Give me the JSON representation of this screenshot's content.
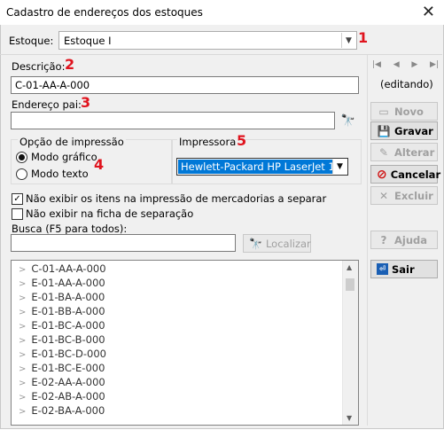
{
  "window": {
    "title": "Cadastro de endereços dos estoques",
    "close_glyph": "✕"
  },
  "stock": {
    "label": "Estoque:",
    "value": "Estoque I",
    "marker": "1"
  },
  "description": {
    "label": "Descrição:",
    "value": "C-01-AA-A-000",
    "marker": "2"
  },
  "parent_address": {
    "label": "Endereço pai:",
    "value": "",
    "marker": "3"
  },
  "print_option": {
    "label": "Opção de impressão",
    "options": [
      "Modo gráfico",
      "Modo texto"
    ],
    "selected": "Modo gráfico",
    "marker": "4"
  },
  "printer": {
    "label": "Impressora",
    "value": "Hewlett-Packard HP LaserJet 1",
    "marker": "5"
  },
  "checkboxes": [
    {
      "label": "Não exibir os itens na impressão de mercadorias a separar",
      "checked": true
    },
    {
      "label": "Não exibir na ficha de separação",
      "checked": false
    }
  ],
  "search": {
    "label": "Busca (F5 para todos):",
    "value": "",
    "button": "Localizar"
  },
  "tree_items": [
    "C-01-AA-A-000",
    "E-01-AA-A-000",
    "E-01-BA-A-000",
    "E-01-BB-A-000",
    "E-01-BC-A-000",
    "E-01-BC-B-000",
    "E-01-BC-D-000",
    "E-01-BC-E-000",
    "E-02-AA-A-000",
    "E-02-AB-A-000",
    "E-02-BA-A-000"
  ],
  "nav": {
    "status": "(editando)",
    "glyphs": [
      "|◀",
      "◀",
      "▶",
      "▶|"
    ]
  },
  "actions": {
    "new": "Novo",
    "save": "Gravar",
    "edit": "Alterar",
    "cancel": "Cancelar",
    "delete": "Excluir",
    "help": "Ajuda",
    "exit": "Sair"
  },
  "colors": {
    "marker": "#e0141e",
    "selection": "#0078d7"
  }
}
